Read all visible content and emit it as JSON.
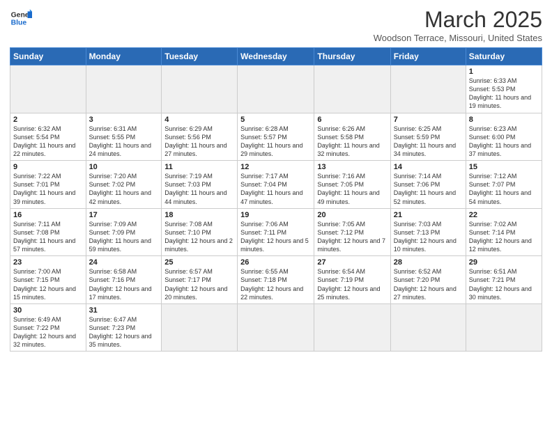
{
  "header": {
    "logo_line1": "General",
    "logo_line2": "Blue",
    "title": "March 2025",
    "subtitle": "Woodson Terrace, Missouri, United States"
  },
  "weekdays": [
    "Sunday",
    "Monday",
    "Tuesday",
    "Wednesday",
    "Thursday",
    "Friday",
    "Saturday"
  ],
  "weeks": [
    [
      {
        "day": "",
        "empty": true
      },
      {
        "day": "",
        "empty": true
      },
      {
        "day": "",
        "empty": true
      },
      {
        "day": "",
        "empty": true
      },
      {
        "day": "",
        "empty": true
      },
      {
        "day": "",
        "empty": true
      },
      {
        "day": "1",
        "info": "Sunrise: 6:33 AM\nSunset: 5:53 PM\nDaylight: 11 hours\nand 19 minutes."
      }
    ],
    [
      {
        "day": "2",
        "info": "Sunrise: 6:32 AM\nSunset: 5:54 PM\nDaylight: 11 hours\nand 22 minutes."
      },
      {
        "day": "3",
        "info": "Sunrise: 6:31 AM\nSunset: 5:55 PM\nDaylight: 11 hours\nand 24 minutes."
      },
      {
        "day": "4",
        "info": "Sunrise: 6:29 AM\nSunset: 5:56 PM\nDaylight: 11 hours\nand 27 minutes."
      },
      {
        "day": "5",
        "info": "Sunrise: 6:28 AM\nSunset: 5:57 PM\nDaylight: 11 hours\nand 29 minutes."
      },
      {
        "day": "6",
        "info": "Sunrise: 6:26 AM\nSunset: 5:58 PM\nDaylight: 11 hours\nand 32 minutes."
      },
      {
        "day": "7",
        "info": "Sunrise: 6:25 AM\nSunset: 5:59 PM\nDaylight: 11 hours\nand 34 minutes."
      },
      {
        "day": "8",
        "info": "Sunrise: 6:23 AM\nSunset: 6:00 PM\nDaylight: 11 hours\nand 37 minutes."
      }
    ],
    [
      {
        "day": "9",
        "info": "Sunrise: 7:22 AM\nSunset: 7:01 PM\nDaylight: 11 hours\nand 39 minutes."
      },
      {
        "day": "10",
        "info": "Sunrise: 7:20 AM\nSunset: 7:02 PM\nDaylight: 11 hours\nand 42 minutes."
      },
      {
        "day": "11",
        "info": "Sunrise: 7:19 AM\nSunset: 7:03 PM\nDaylight: 11 hours\nand 44 minutes."
      },
      {
        "day": "12",
        "info": "Sunrise: 7:17 AM\nSunset: 7:04 PM\nDaylight: 11 hours\nand 47 minutes."
      },
      {
        "day": "13",
        "info": "Sunrise: 7:16 AM\nSunset: 7:05 PM\nDaylight: 11 hours\nand 49 minutes."
      },
      {
        "day": "14",
        "info": "Sunrise: 7:14 AM\nSunset: 7:06 PM\nDaylight: 11 hours\nand 52 minutes."
      },
      {
        "day": "15",
        "info": "Sunrise: 7:12 AM\nSunset: 7:07 PM\nDaylight: 11 hours\nand 54 minutes."
      }
    ],
    [
      {
        "day": "16",
        "info": "Sunrise: 7:11 AM\nSunset: 7:08 PM\nDaylight: 11 hours\nand 57 minutes."
      },
      {
        "day": "17",
        "info": "Sunrise: 7:09 AM\nSunset: 7:09 PM\nDaylight: 11 hours\nand 59 minutes."
      },
      {
        "day": "18",
        "info": "Sunrise: 7:08 AM\nSunset: 7:10 PM\nDaylight: 12 hours\nand 2 minutes."
      },
      {
        "day": "19",
        "info": "Sunrise: 7:06 AM\nSunset: 7:11 PM\nDaylight: 12 hours\nand 5 minutes."
      },
      {
        "day": "20",
        "info": "Sunrise: 7:05 AM\nSunset: 7:12 PM\nDaylight: 12 hours\nand 7 minutes."
      },
      {
        "day": "21",
        "info": "Sunrise: 7:03 AM\nSunset: 7:13 PM\nDaylight: 12 hours\nand 10 minutes."
      },
      {
        "day": "22",
        "info": "Sunrise: 7:02 AM\nSunset: 7:14 PM\nDaylight: 12 hours\nand 12 minutes."
      }
    ],
    [
      {
        "day": "23",
        "info": "Sunrise: 7:00 AM\nSunset: 7:15 PM\nDaylight: 12 hours\nand 15 minutes."
      },
      {
        "day": "24",
        "info": "Sunrise: 6:58 AM\nSunset: 7:16 PM\nDaylight: 12 hours\nand 17 minutes."
      },
      {
        "day": "25",
        "info": "Sunrise: 6:57 AM\nSunset: 7:17 PM\nDaylight: 12 hours\nand 20 minutes."
      },
      {
        "day": "26",
        "info": "Sunrise: 6:55 AM\nSunset: 7:18 PM\nDaylight: 12 hours\nand 22 minutes."
      },
      {
        "day": "27",
        "info": "Sunrise: 6:54 AM\nSunset: 7:19 PM\nDaylight: 12 hours\nand 25 minutes."
      },
      {
        "day": "28",
        "info": "Sunrise: 6:52 AM\nSunset: 7:20 PM\nDaylight: 12 hours\nand 27 minutes."
      },
      {
        "day": "29",
        "info": "Sunrise: 6:51 AM\nSunset: 7:21 PM\nDaylight: 12 hours\nand 30 minutes."
      }
    ],
    [
      {
        "day": "30",
        "info": "Sunrise: 6:49 AM\nSunset: 7:22 PM\nDaylight: 12 hours\nand 32 minutes."
      },
      {
        "day": "31",
        "info": "Sunrise: 6:47 AM\nSunset: 7:23 PM\nDaylight: 12 hours\nand 35 minutes."
      },
      {
        "day": "",
        "empty": true
      },
      {
        "day": "",
        "empty": true
      },
      {
        "day": "",
        "empty": true
      },
      {
        "day": "",
        "empty": true
      },
      {
        "day": "",
        "empty": true
      }
    ]
  ]
}
